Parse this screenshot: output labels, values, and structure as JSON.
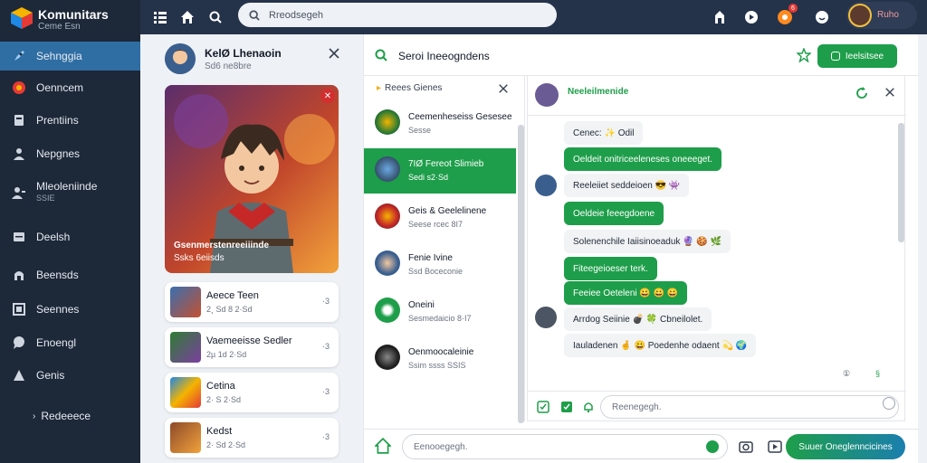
{
  "brand": {
    "title": "Komunitars",
    "subtitle": "Ceme Esn",
    "logo_icon": "cube-logo-icon"
  },
  "sidebar": {
    "items": [
      {
        "label": "Sehnggia",
        "icon": "rocket-icon",
        "active": true
      },
      {
        "label": "Oenncem",
        "icon": "gamepad-icon"
      },
      {
        "label": "Prentiins",
        "icon": "trophy-icon"
      },
      {
        "label": "Nepgnes",
        "icon": "people-icon"
      },
      {
        "label": "Mleoleniinde",
        "sub": "SSIE",
        "icon": "user-group-icon"
      },
      {
        "label": "Deelsh",
        "icon": "layers-icon"
      },
      {
        "label": "Beensds",
        "icon": "shield-icon"
      },
      {
        "label": "Seennes",
        "icon": "monitor-icon"
      },
      {
        "label": "Enoengl",
        "icon": "chat-icon"
      },
      {
        "label": "Genis",
        "icon": "bell-icon"
      },
      {
        "label": "Redeeece",
        "icon": "chevron-right-icon"
      }
    ]
  },
  "topbar": {
    "search_placeholder": "Rreodsegeh",
    "notification_count": "6",
    "user_name": "Ruho"
  },
  "profile": {
    "name": "KelØ Lhenaoin",
    "sub": "Sd6 ne8bre",
    "hero_caption_1": "Gsenmerstenreeiiinde",
    "hero_caption_2": "Ssks 6eiisds"
  },
  "games": [
    {
      "title": "Aeece Teen",
      "stat": "2¸ Sd 8 2·Sd",
      "meta": "·3"
    },
    {
      "title": "Vaemeeisse Sedler",
      "stat": "2µ 1d 2·Sd",
      "meta": "·3"
    },
    {
      "title": "Cetina",
      "stat": "2· S 2·Sd",
      "meta": "·3"
    },
    {
      "title": "Kedst",
      "stat": "2· Sd 2·Sd",
      "meta": "·3"
    }
  ],
  "chat_panel": {
    "title": "Seroi Ineeogndens",
    "new_button": "Ieelsitsee"
  },
  "contacts": {
    "header": "Reees Gienes",
    "list": [
      {
        "name": "Ceemenheseiss Gesesee",
        "sub": "Sesse",
        "active": false
      },
      {
        "name": "7IØ Fereot Slimieb",
        "sub": "Sedi s2·Sd",
        "active": true
      },
      {
        "name": "Geis & Geelelinene",
        "sub": "Seese rcec 8I7",
        "active": false
      },
      {
        "name": "Fenie Ivine",
        "sub": "Ssd Boceconie",
        "active": false
      },
      {
        "name": "Oneini",
        "sub": "Sesmedaicio 8·I7",
        "active": false
      },
      {
        "name": "Oenmoocaleinie",
        "sub": "Ssim ssss SSIS",
        "active": false
      }
    ]
  },
  "chat": {
    "name": "Neeleilmenide",
    "messages": [
      {
        "text": "Cenec: ✨ Odil",
        "type": "in"
      },
      {
        "text": "Oeldeit onitriceeleneses oneeeget.",
        "type": "out"
      },
      {
        "text": "Reeleiiet seddeioen 😎 👾",
        "type": "in"
      },
      {
        "text": "Oeldeie feeegdoene",
        "type": "out"
      },
      {
        "text": "Solenenchile Iaiisinoeaduk 🔮 🍪 🌿",
        "type": "in"
      },
      {
        "text": "Fiteegeioeser terk.",
        "type": "out"
      },
      {
        "text": "Feeiee Oeteleni 😀 😀 😀",
        "type": "out"
      },
      {
        "text": "Arrdog Seiinie 💣 🍀 Cbneilolet.",
        "type": "in"
      },
      {
        "text": "Iauladenen 🤞 😀 Poedenhe odaent 💫 🌍",
        "type": "in"
      }
    ],
    "meta_left": "①",
    "meta_right": "§",
    "input_placeholder": "Reenegegh."
  },
  "composer": {
    "placeholder": "Eenooegegh.",
    "send_label": "Suuer Oneglenncicines"
  },
  "colors": {
    "accent_green": "#1e9e4a",
    "nav_bg": "#1d2838",
    "active_nav": "#2f6ea3"
  }
}
